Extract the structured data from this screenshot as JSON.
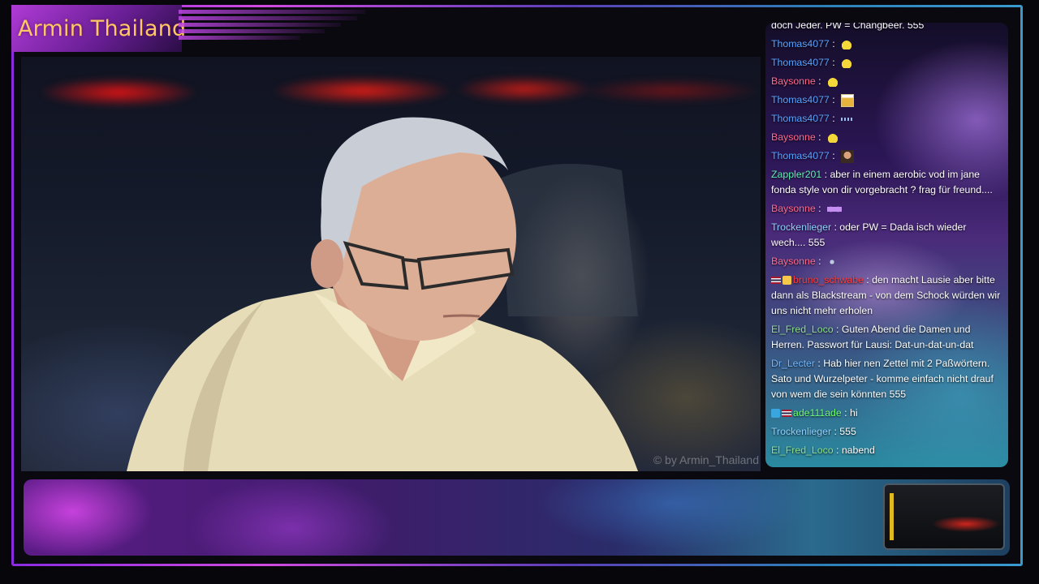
{
  "stream": {
    "channel_title": "Armin Thailand",
    "video_watermark": "© by Armin_Thailand"
  },
  "chat": {
    "messages": [
      {
        "user": "",
        "text": "doch Jeder. PW = Changbeer. 555",
        "color": "#ffffff",
        "emote": null
      },
      {
        "user": "Thomas4077",
        "text": "",
        "color": "#5aa3ff",
        "emote": "duck"
      },
      {
        "user": "Thomas4077",
        "text": "",
        "color": "#5aa3ff",
        "emote": "duck"
      },
      {
        "user": "Baysonne",
        "text": "",
        "color": "#ff6a8a",
        "emote": "duck"
      },
      {
        "user": "Thomas4077",
        "text": "",
        "color": "#5aa3ff",
        "emote": "beer"
      },
      {
        "user": "Thomas4077",
        "text": "",
        "color": "#5aa3ff",
        "emote": "dots"
      },
      {
        "user": "Baysonne",
        "text": "",
        "color": "#ff6a8a",
        "emote": "duck"
      },
      {
        "user": "Thomas4077",
        "text": "",
        "color": "#5aa3ff",
        "emote": "face"
      },
      {
        "user": "Zappler201",
        "text": "aber in einem aerobic vod im jane fonda style von dir vorgebracht ? frag für freund....",
        "color": "#5ef0b0",
        "emote": null
      },
      {
        "user": "Baysonne",
        "text": "",
        "color": "#ff6a8a",
        "emote": "bow"
      },
      {
        "user": "Trockenlieger",
        "text": "oder PW = Dada isch wieder wech.... 555",
        "color": "#8fd0ff",
        "emote": null
      },
      {
        "user": "Baysonne",
        "text": "",
        "color": "#ff6a8a",
        "emote": "hand"
      },
      {
        "user": "bruno_schwabe",
        "text": "den macht Lausie aber bitte dann als Blackstream - von dem Schock würden wir uns nicht mehr erholen",
        "color": "#ff3a3a",
        "emote": null,
        "badges": "thai+gold"
      },
      {
        "user": "El_Fred_Loco",
        "text": "Guten Abend die Damen und Herren. Passwort für Lausi: Dat-un-dat-un-dat",
        "color": "#8fe08f",
        "emote": null
      },
      {
        "user": "Dr_Lecter",
        "text": "Hab hier nen Zettel mit 2 Paßwörtern. Sato und Wurzelpeter - komme einfach nicht drauf von wem die sein könnten 555",
        "color": "#6fb8ff",
        "emote": null
      },
      {
        "user": "ade111ade",
        "text": "hi",
        "color": "#6cff6c",
        "emote": null,
        "badges": "blue+thai"
      },
      {
        "user": "Trockenlieger",
        "text": "555",
        "color": "#8fd0ff",
        "emote": null
      },
      {
        "user": "El_Fred_Loco",
        "text": "nabend",
        "color": "#8fe08f",
        "emote": null
      }
    ]
  }
}
